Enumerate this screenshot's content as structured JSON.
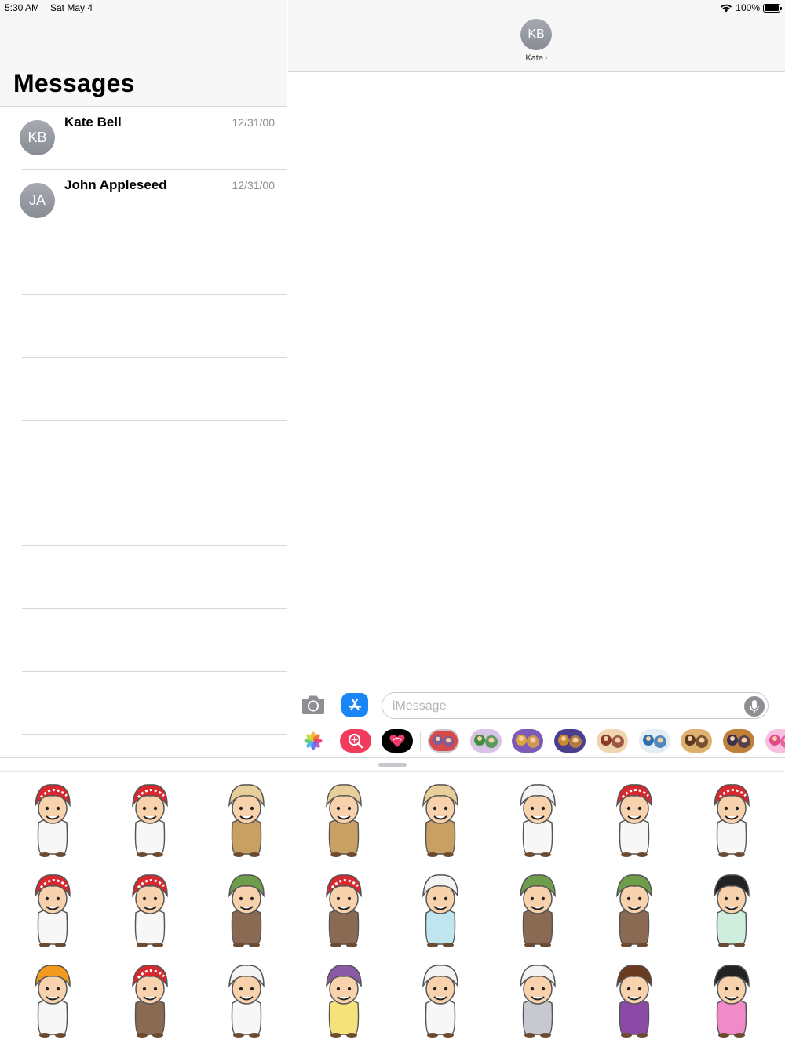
{
  "status_bar": {
    "time": "5:30 AM",
    "date": "Sat May 4",
    "battery": "100%",
    "battery_level": 1.0,
    "icons": [
      "wifi-icon",
      "battery-icon"
    ]
  },
  "sidebar": {
    "title": "Messages",
    "conversations": [
      {
        "initials": "KB",
        "name": "Kate Bell",
        "date": "12/31/00"
      },
      {
        "initials": "JA",
        "name": "John Appleseed",
        "date": "12/31/00"
      }
    ]
  },
  "chat": {
    "contact_initials": "KB",
    "contact_name": "Kate",
    "contact_chevron": "›",
    "compose_placeholder": "iMessage",
    "compose_icons": [
      "camera-icon",
      "app-store-icon",
      "microphone-icon"
    ]
  },
  "app_strip": {
    "apps": [
      "photos-app-icon",
      "search-images-app-icon",
      "digital-touch-app-icon",
      "sticker-pack-1-icon",
      "sticker-pack-2-icon",
      "sticker-pack-3-icon",
      "sticker-pack-4-icon",
      "sticker-pack-5-icon",
      "sticker-pack-6-icon",
      "sticker-pack-7-icon",
      "sticker-pack-8-icon",
      "sticker-pack-9-icon"
    ]
  },
  "stickers": [
    {
      "name": "sticker-boy-red-ghutra-sitting",
      "headwear": "red-checked",
      "outfit": "white"
    },
    {
      "name": "sticker-boy-red-ghutra-standing",
      "headwear": "red-checked",
      "outfit": "white"
    },
    {
      "name": "sticker-boy-turban-brown-robe",
      "headwear": "beige-turban",
      "outfit": "tan"
    },
    {
      "name": "sticker-boy-backpack-running",
      "headwear": "beige-turban",
      "outfit": "tan"
    },
    {
      "name": "sticker-boy-waving-tan",
      "headwear": "beige-turban",
      "outfit": "tan"
    },
    {
      "name": "sticker-man-laughing-white",
      "headwear": "white",
      "outfit": "white"
    },
    {
      "name": "sticker-man-dancing-red-ghutra",
      "headwear": "red-checked",
      "outfit": "white"
    },
    {
      "name": "sticker-man-red-ghutra-pointing",
      "headwear": "red-checked",
      "outfit": "white"
    },
    {
      "name": "sticker-man-red-ghutra-thinking",
      "headwear": "red-checked",
      "outfit": "white"
    },
    {
      "name": "sticker-man-waving-white",
      "headwear": "red-checked",
      "outfit": "white"
    },
    {
      "name": "sticker-man-green-turban-brown",
      "headwear": "green",
      "outfit": "brown"
    },
    {
      "name": "sticker-boy-jumping-red-ghutra",
      "headwear": "red-checked",
      "outfit": "brown"
    },
    {
      "name": "sticker-man-glasses-light-blue",
      "headwear": "white",
      "outfit": "light-blue"
    },
    {
      "name": "sticker-man-green-cap-brown",
      "headwear": "green",
      "outfit": "brown"
    },
    {
      "name": "sticker-man-green-cap-sitting",
      "headwear": "green",
      "outfit": "brown"
    },
    {
      "name": "sticker-man-orange-face-green-robe",
      "headwear": "black",
      "outfit": "light-green"
    },
    {
      "name": "sticker-man-reading-newspaper",
      "headwear": "orange",
      "outfit": "white"
    },
    {
      "name": "sticker-man-shouting-red-ghutra",
      "headwear": "red-checked",
      "outfit": "brown"
    },
    {
      "name": "sticker-chef-thinking",
      "headwear": "white",
      "outfit": "white"
    },
    {
      "name": "sticker-man-yellow-robe",
      "headwear": "purple",
      "outfit": "yellow"
    },
    {
      "name": "sticker-man-white-cap-standing",
      "headwear": "white",
      "outfit": "white"
    },
    {
      "name": "sticker-man-dancing-grey",
      "headwear": "white",
      "outfit": "grey"
    },
    {
      "name": "sticker-girl-flag-purple-dress",
      "headwear": "brown-hair",
      "outfit": "purple"
    },
    {
      "name": "sticker-girl-hijab-pink",
      "headwear": "black",
      "outfit": "pink"
    }
  ]
}
